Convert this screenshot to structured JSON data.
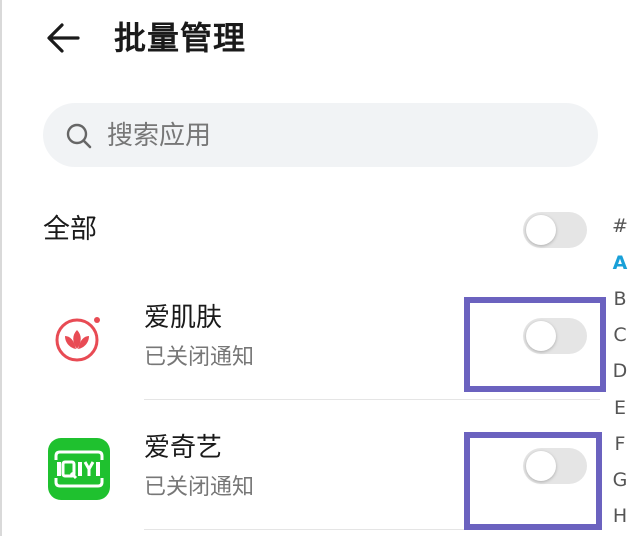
{
  "header": {
    "title": "批量管理"
  },
  "search": {
    "placeholder": "搜索应用"
  },
  "all_toggle": {
    "label": "全部",
    "on": false
  },
  "apps": [
    {
      "name": "爱肌肤",
      "status": "已关闭通知",
      "notifications_on": false,
      "icon": "lotus-icon",
      "icon_color": "#e84b54"
    },
    {
      "name": "爱奇艺",
      "status": "已关闭通知",
      "notifications_on": false,
      "icon": "iqiyi-icon",
      "icon_color": "#1fc12f"
    }
  ],
  "alphabet_index": {
    "letters": [
      "#",
      "A",
      "B",
      "C",
      "D",
      "E",
      "F",
      "G",
      "H"
    ],
    "active": "A"
  },
  "colors": {
    "accent": "#19a0d8",
    "toggle_off": "#e5e5e5",
    "highlight": "#6b62bf",
    "secondary_text": "#777777"
  }
}
